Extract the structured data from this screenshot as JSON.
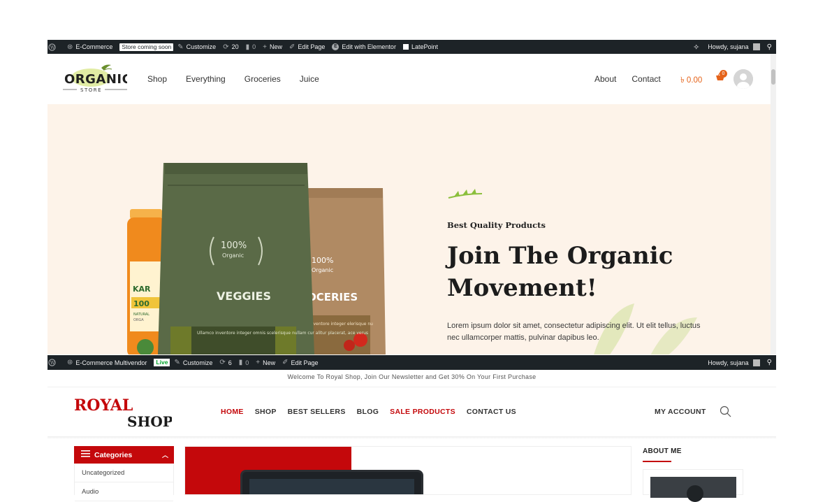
{
  "admin_bar_1": {
    "site_name": "E-Commerce",
    "store_status": "Store coming soon",
    "customize": "Customize",
    "updates": "20",
    "comments": "0",
    "new": "New",
    "edit_page": "Edit Page",
    "edit_elementor": "Edit with Elementor",
    "latepoint": "LatePoint",
    "greeting": "Howdy, sujana"
  },
  "organic": {
    "logo_main": "ORGANIC",
    "logo_sub": "STORE",
    "nav": [
      "Shop",
      "Everything",
      "Groceries",
      "Juice"
    ],
    "right_nav": [
      "About",
      "Contact"
    ],
    "cart_total": "৳ 0.00",
    "cart_count": "0",
    "hero": {
      "subtitle": "Best Quality Products",
      "title": "Join The Organic Movement!",
      "text": "Lorem ipsum dolor sit amet, consectetur adipiscing elit. Ut elit tellus, luctus nec ullamcorper mattis, pulvinar dapibus leo.",
      "bag_front": {
        "badge_pct": "100%",
        "badge_word": "Organic",
        "label": "VEGGIES",
        "small_text": "Ullamco inventore integer omnis scelerisque nullam cur alitur placerat, ace verus"
      },
      "bag_back": {
        "badge_pct": "100%",
        "badge_word": "Organic",
        "label": "OCERIES",
        "small_text": "inventore integer elerisque nu"
      },
      "jar_label": "KAR",
      "jar_pct": "100",
      "jar_small": "NATURAL",
      "jar_small2": "ORGA"
    }
  },
  "admin_bar_2": {
    "site_name": "E-Commerce Multivendor",
    "status": "Live",
    "customize": "Customize",
    "updates": "6",
    "comments": "0",
    "new": "New",
    "edit_page": "Edit Page",
    "greeting": "Howdy, sujana"
  },
  "royal": {
    "welcome": "Welcome To Royal Shop, Join Our Newsletter and Get 30% On Your First Purchase",
    "logo_top": "ROYAL",
    "logo_bottom": "SHOP",
    "nav": [
      "HOME",
      "SHOP",
      "BEST SELLERS",
      "BLOG",
      "SALE PRODUCTS",
      "CONTACT US"
    ],
    "account": "MY ACCOUNT",
    "categories_label": "Categories",
    "categories": [
      "Uncategorized",
      "Audio"
    ],
    "about_heading": "ABOUT ME"
  },
  "colors": {
    "admin_bar": "#1d2327",
    "organic_accent": "#e5631a",
    "hero_bg": "#fdf3e9",
    "royal_red": "#c4080b"
  }
}
